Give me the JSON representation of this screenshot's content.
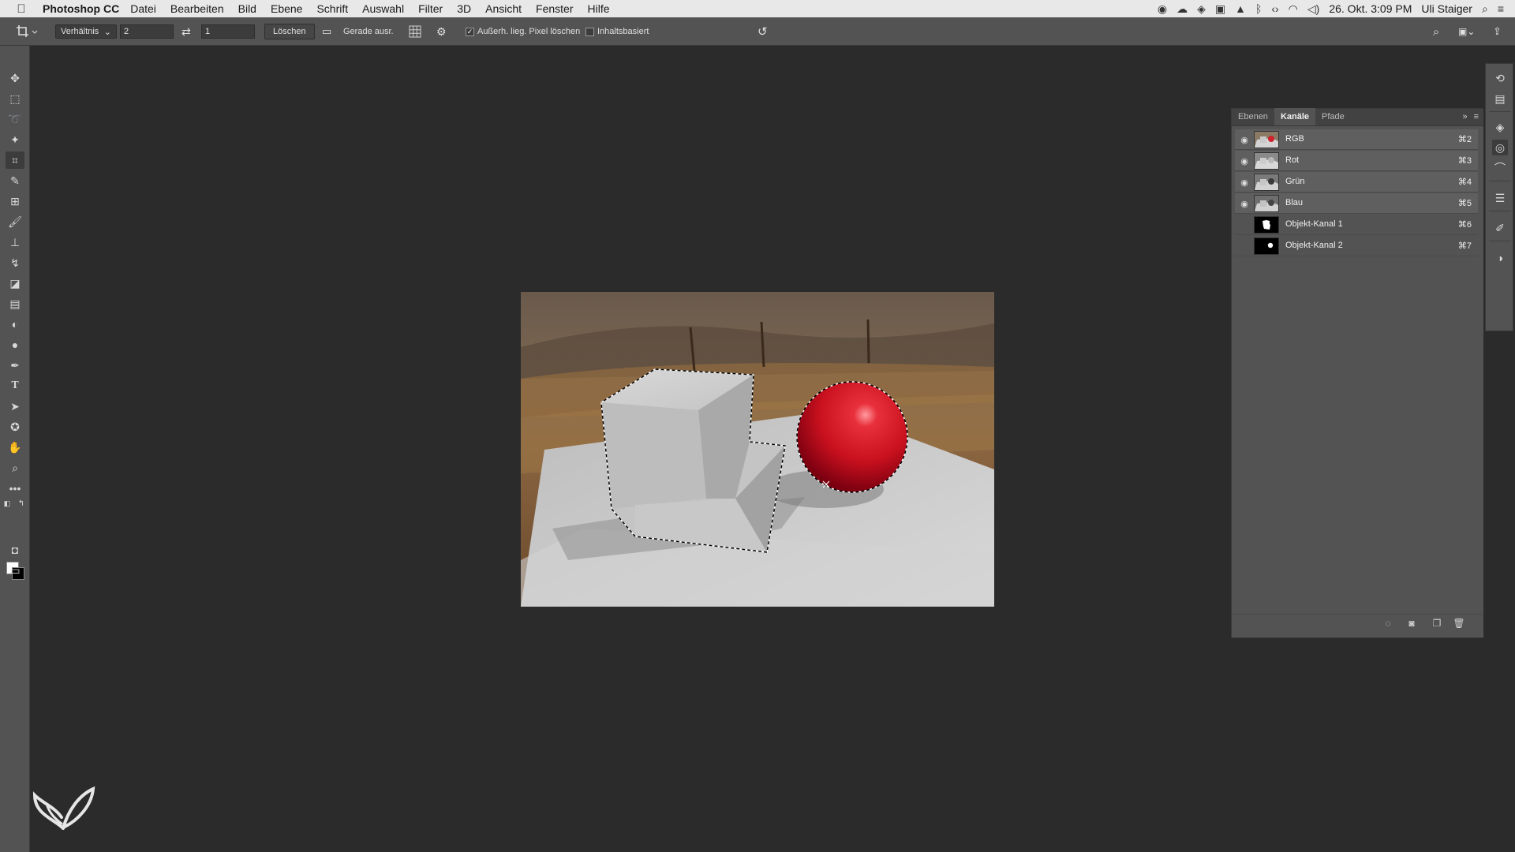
{
  "menubar": {
    "apple_icon": "apple-icon",
    "app_name": "Photoshop CC",
    "items": [
      "Datei",
      "Bearbeiten",
      "Bild",
      "Ebene",
      "Schrift",
      "Auswahl",
      "Filter",
      "3D",
      "Ansicht",
      "Fenster",
      "Hilfe"
    ],
    "date_time": "26. Okt. 3:09 PM",
    "user": "Uli Staiger"
  },
  "options": {
    "ratio_label": "Verhältnis",
    "width_value": "2",
    "height_value": "1",
    "clear_button": "Löschen",
    "straighten_label": "Gerade ausr.",
    "delete_pixels_label": "Außerh. lieg. Pixel löschen",
    "delete_pixels_checked": true,
    "content_aware_label": "Inhaltsbasiert",
    "content_aware_checked": false
  },
  "tools": [
    "move-tool-icon",
    "marquee-tool-icon",
    "lasso-tool-icon",
    "magic-wand-icon",
    "crop-tool-icon",
    "eyedropper-icon",
    "patch-tool-icon",
    "brush-tool-icon",
    "stamp-tool-icon",
    "history-brush-icon",
    "eraser-icon",
    "gradient-icon",
    "blur-icon",
    "dodge-icon",
    "pen-tool-icon",
    "type-tool-icon",
    "path-selection-icon",
    "shape-tool-icon",
    "hand-tool-icon",
    "zoom-tool-icon",
    "more-tools-icon"
  ],
  "colors": {
    "foreground": "#ffffff",
    "background": "#000000",
    "ui_panel": "#535353",
    "workspace": "#2b2b2b"
  },
  "panel": {
    "tabs": [
      "Ebenen",
      "Kanäle",
      "Pfade"
    ],
    "active_tab": "Kanäle",
    "channels": [
      {
        "name": "RGB",
        "shortcut": "⌘2",
        "visible": true
      },
      {
        "name": "Rot",
        "shortcut": "⌘3",
        "visible": true
      },
      {
        "name": "Grün",
        "shortcut": "⌘4",
        "visible": true
      },
      {
        "name": "Blau",
        "shortcut": "⌘5",
        "visible": true
      },
      {
        "name": "Objekt-Kanal 1",
        "shortcut": "⌘6",
        "visible": false
      },
      {
        "name": "Objekt-Kanal 2",
        "shortcut": "⌘7",
        "visible": false
      }
    ]
  }
}
